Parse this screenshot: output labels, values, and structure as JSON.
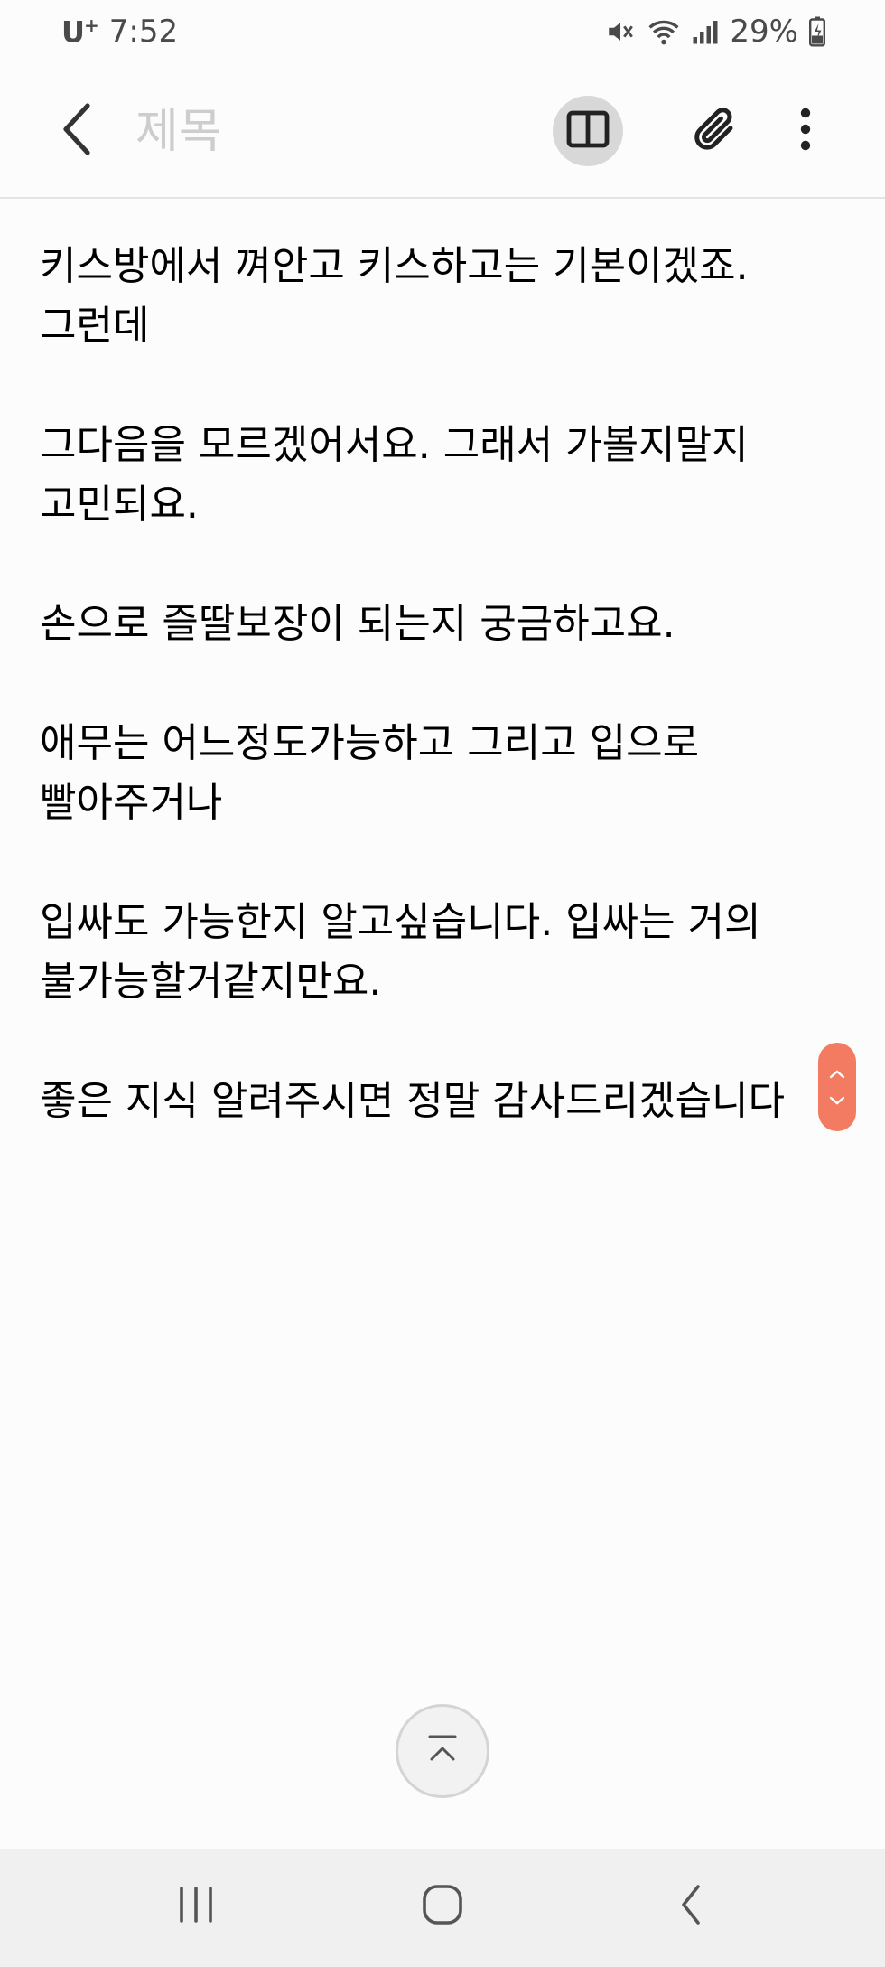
{
  "status_bar": {
    "carrier": "U",
    "carrier_plus": "+",
    "time": "7:52",
    "battery_percent": "29%",
    "icons": [
      "mute-icon",
      "wifi-icon",
      "signal-icon",
      "battery-icon"
    ]
  },
  "toolbar": {
    "back_icon": "chevron-left-icon",
    "title_placeholder": "제목",
    "reading_mode_icon": "book-icon",
    "attach_icon": "paperclip-icon",
    "more_icon": "more-vertical-icon"
  },
  "note": {
    "paragraphs": [
      "키스방에서 껴안고 키스하고는 기본이겠죠.그런데",
      "그다음을 모르겠어서요. 그래서 가볼지말지 고민되요.",
      "손으로 즐딸보장이 되는지 궁금하고요.",
      "애무는 어느정도가능하고 그리고 입으로 빨아주거나",
      "입싸도 가능한지 알고싶습니다. 입싸는 거의 불가능할거같지만요.",
      "좋은 지식 알려주시면 정말 감사드리겠습니다"
    ]
  },
  "colors": {
    "accent": "#f27b62",
    "background": "#fcfcfc",
    "nav_background": "#f0f0f0",
    "placeholder": "#cdcdcd"
  },
  "nav_bar": {
    "icons": [
      "recent-apps-icon",
      "home-icon",
      "back-icon"
    ]
  }
}
